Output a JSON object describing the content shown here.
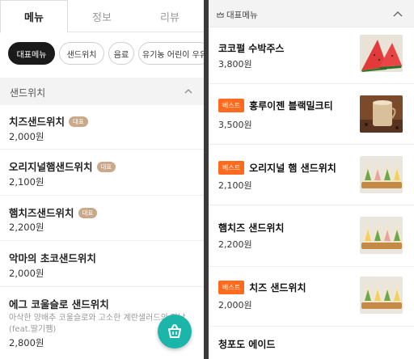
{
  "left": {
    "tabs": [
      {
        "label": "메뉴"
      },
      {
        "label": "정보"
      },
      {
        "label": "리뷰"
      }
    ],
    "chips": [
      {
        "label": "대표메뉴"
      },
      {
        "label": "샌드위치"
      },
      {
        "label": "음료"
      },
      {
        "label": "유기농 어린이 우유"
      }
    ],
    "section_title": "샌드위치",
    "items": [
      {
        "name": "치즈샌드위치",
        "tag": "대표",
        "price": "2,000원"
      },
      {
        "name": "오리지널햄샌드위치",
        "tag": "대표",
        "price": "2,100원"
      },
      {
        "name": "햄치즈샌드위치",
        "tag": "대표",
        "price": "2,200원"
      },
      {
        "name": "악마의 초코샌드위치",
        "price": "2,000원"
      },
      {
        "name": "에그 코울슬로 샌드위치",
        "desc": "아삭한 양배추 코울슬로와 고소한 계란샐러드의 만남",
        "desc2": "(feat.딸기쨈)",
        "price": "2,800원"
      }
    ]
  },
  "right": {
    "section_title": "대표메뉴",
    "best_label": "베스트",
    "items": [
      {
        "name": "코코펄 수박주스",
        "price": "3,800원"
      },
      {
        "name": "홍루이젠 블랙밀크티",
        "price": "3,500원"
      },
      {
        "name": "오리지널 햄 샌드위치",
        "price": "2,100원"
      },
      {
        "name": "햄치즈 샌드위치",
        "price": "2,200원"
      },
      {
        "name": "치즈 샌드위치",
        "price": "2,000원"
      },
      {
        "name": "청포도 에이드"
      }
    ]
  },
  "colors": {
    "accent": "#1bb5a9",
    "best_badge": "#ff6a1f",
    "tag_badge": "#c9a98a",
    "chip_active": "#1a1a1a"
  },
  "icons": [
    "chevron-up-icon",
    "cart-icon",
    "crown-icon"
  ]
}
